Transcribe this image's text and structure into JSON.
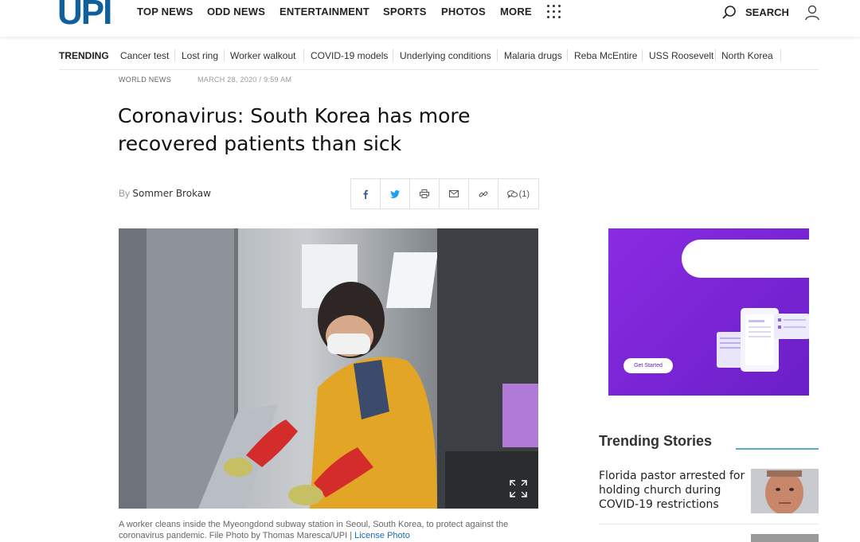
{
  "header": {
    "logo": "UPI",
    "nav": [
      "TOP NEWS",
      "ODD NEWS",
      "ENTERTAINMENT",
      "SPORTS",
      "PHOTOS",
      "MORE"
    ],
    "search_label": "SEARCH"
  },
  "trending": {
    "label": "TRENDING",
    "items": [
      "Cancer test",
      "Lost ring",
      "Worker walkout",
      "COVID-19 models",
      "Underlying conditions",
      "Malaria drugs",
      "Reba McEntire",
      "USS Roosevelt",
      "North Korea"
    ]
  },
  "article": {
    "category": "WORLD NEWS",
    "timestamp": "MARCH 28, 2020 / 9:59 AM",
    "headline": "Coronavirus: South Korea has more recovered patients than sick",
    "byline_prefix": "By",
    "author": "Sommer Brokaw",
    "comments_count": "(1)",
    "caption": "A worker cleans inside the Myeongdond subway station in Seoul, South Korea, to protect against the coronavirus pandemic. File Photo by Thomas Maresca/UPI | ",
    "caption_link": "License Photo"
  },
  "ad": {
    "cta": "Get Started"
  },
  "trending_stories": {
    "title": "Trending Stories",
    "items": [
      {
        "title": "Florida pastor arrested for holding church during COVID-19 restrictions"
      }
    ]
  },
  "icons": {
    "share": [
      "facebook-icon",
      "twitter-icon",
      "print-icon",
      "email-icon",
      "link-icon",
      "comment-icon"
    ]
  },
  "colors": {
    "brand": "#0f5f9c",
    "accent_rule": "#5aa9c4",
    "ad_purple": "#7b26d9",
    "link": "#1a6ab3"
  }
}
